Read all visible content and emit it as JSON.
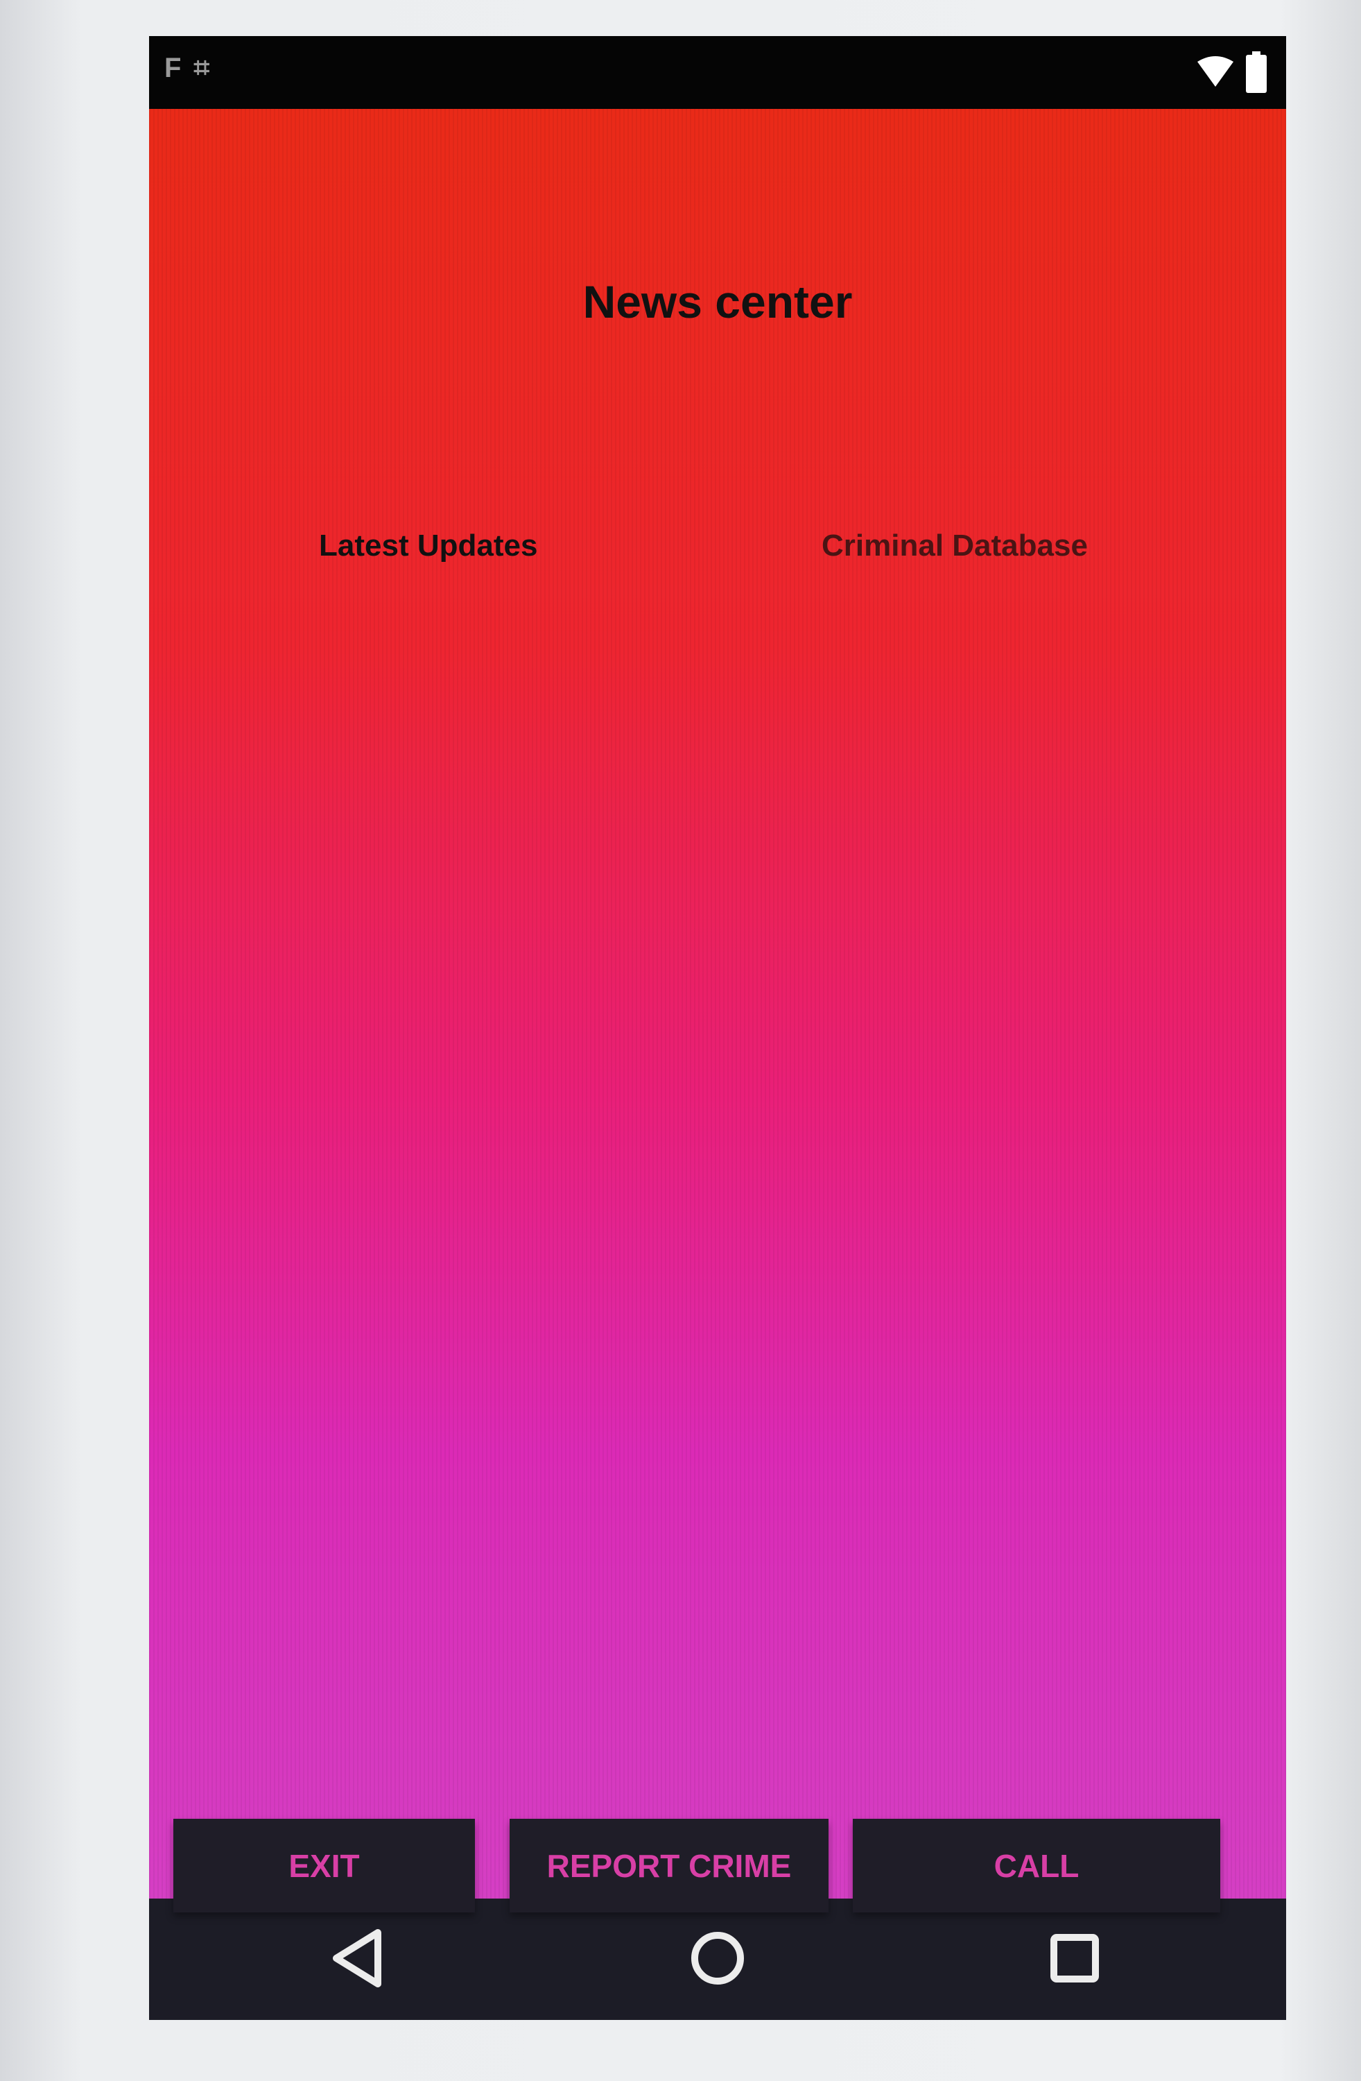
{
  "status_bar": {
    "left_glyphs": [
      "F",
      "⌗"
    ],
    "right_icons": [
      "wifi-icon",
      "battery-icon"
    ]
  },
  "page": {
    "title": "News center"
  },
  "links": {
    "latest_updates": "Latest Updates",
    "criminal_database": "Criminal Database"
  },
  "buttons": {
    "exit": "EXIT",
    "report_crime": "REPORT CRIME",
    "call": "CALL"
  },
  "nav_bar": {
    "items": [
      "back-icon",
      "home-icon",
      "recent-apps-icon"
    ]
  },
  "colors": {
    "gradient_top": "#ea2a18",
    "gradient_middle": "#ea1f78",
    "gradient_bottom": "#d53fc4",
    "button_background": "#1f1d28",
    "button_text": "#d83fa6",
    "system_bar": "#1c1c26"
  }
}
